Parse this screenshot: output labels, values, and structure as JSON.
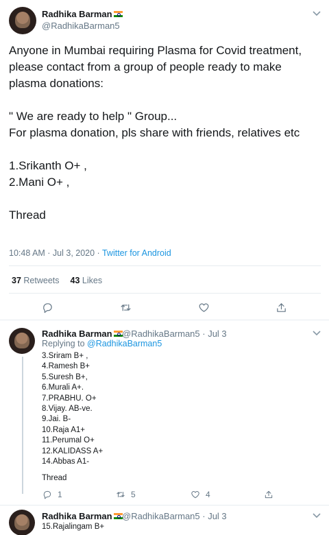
{
  "main_tweet": {
    "name": "Radhika Barman",
    "handle": "@RadhikaBarman5",
    "text": "Anyone in Mumbai requiring Plasma for Covid treatment, please contact from a group of people ready to make plasma donations:\n\n\" We are ready to help \" Group...\n For plasma donation, pls share with friends, relatives etc\n\n1.Srikanth O+ ,\n2.Mani O+ ,\n\nThread",
    "timestamp": "10:48 AM · Jul 3, 2020 · ",
    "source": "Twitter for Android",
    "retweets_count": "37",
    "retweets_label": "Retweets",
    "likes_count": "43",
    "likes_label": "Likes"
  },
  "reply_1": {
    "name": "Radhika Barman",
    "meta": "@RadhikaBarman5 · Jul 3",
    "replying_prefix": "Replying to ",
    "replying_handle": "@RadhikaBarman5",
    "text": "3.Sriram B+ ,\n4.Ramesh B+\n5.Suresh B+,\n6.Murali  A+.\n7.PRABHU. O+\n8.Vijay. AB-ve.\n9.Jai. B-\n10.Raja A1+\n11.Perumal O+\n12.KALIDASS A+\n14.Abbas A1-",
    "thread_label": "Thread",
    "reply_count": "1",
    "retweet_count": "5",
    "like_count": "4"
  },
  "reply_2": {
    "name": "Radhika Barman",
    "meta": "@RadhikaBarman5 · Jul 3",
    "text": "15.Rajalingam B+"
  },
  "icons": [
    "avatar",
    "india-flag-icon",
    "chevron-down-icon",
    "reply-icon",
    "retweet-icon",
    "like-icon",
    "share-icon"
  ],
  "colors": {
    "link": "#1b95e0",
    "muted": "#657786",
    "text": "#14171a",
    "border": "#e6ecf0"
  }
}
